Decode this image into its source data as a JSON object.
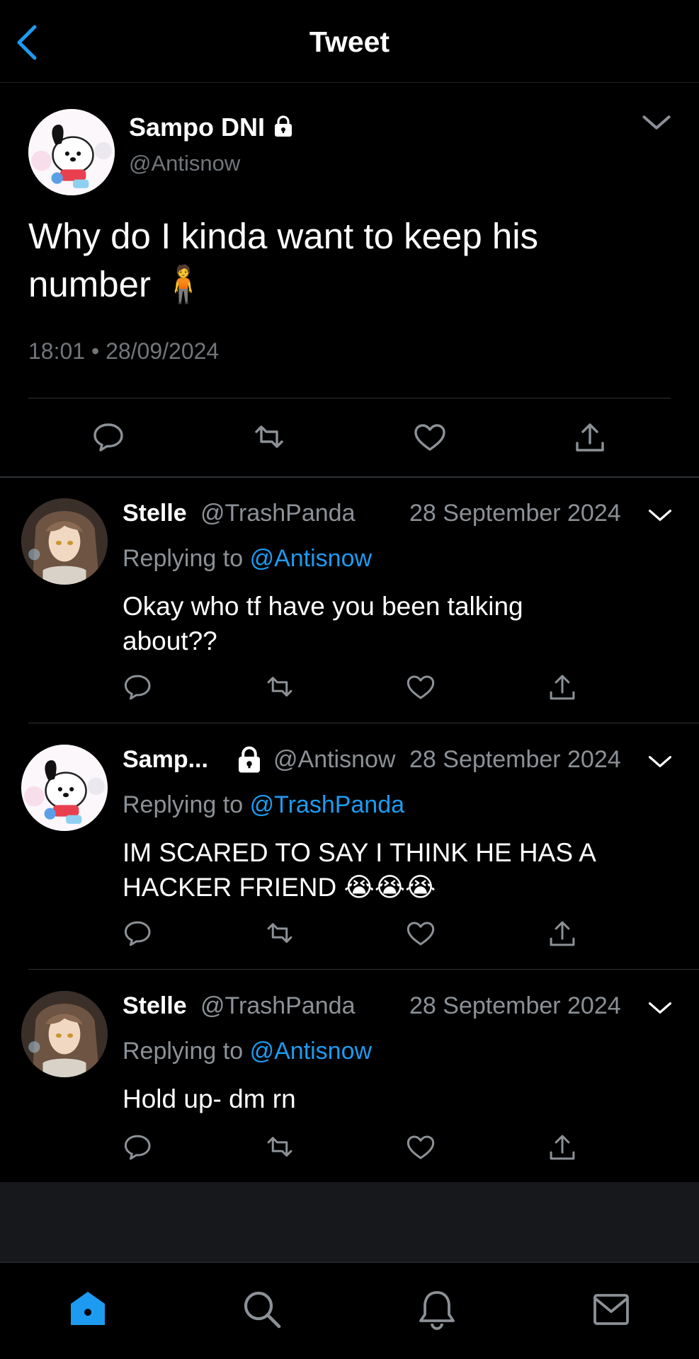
{
  "header": {
    "title": "Tweet"
  },
  "tweet": {
    "name": "Sampo DNI",
    "handle": "@Antisnow",
    "text": "Why do I kinda want to keep his number 🧍",
    "timestamp": "18:01 • 28/09/2024"
  },
  "replies": [
    {
      "name": "Stelle",
      "handle": "@TrashPanda",
      "date": "28 September 2024",
      "replying_label": "Replying to",
      "replying_to": "@Antisnow",
      "text": "Okay who tf have you been talking about??"
    },
    {
      "name": "Samp...",
      "handle": "@Antisnow",
      "date": "28 September 2024",
      "replying_label": "Replying to",
      "replying_to": "@TrashPanda",
      "text": "IM SCARED TO SAY I THINK HE HAS A HACKER FRIEND 😭😭😭"
    },
    {
      "name": "Stelle",
      "handle": "@TrashPanda",
      "date": "28 September 2024",
      "replying_label": "Replying to",
      "replying_to": "@Antisnow",
      "text": "Hold up- dm rn"
    }
  ],
  "icons": {
    "back": "chevron-left-icon",
    "lock": "lock-icon",
    "more": "chevron-down-icon",
    "reply": "reply-icon",
    "retweet": "retweet-icon",
    "like": "heart-icon",
    "share": "share-icon",
    "home": "home-icon",
    "search": "search-icon",
    "notifications": "bell-icon",
    "messages": "mail-icon"
  },
  "colors": {
    "accent": "#1d9bf0",
    "background": "#000000",
    "muted": "#71767b"
  }
}
